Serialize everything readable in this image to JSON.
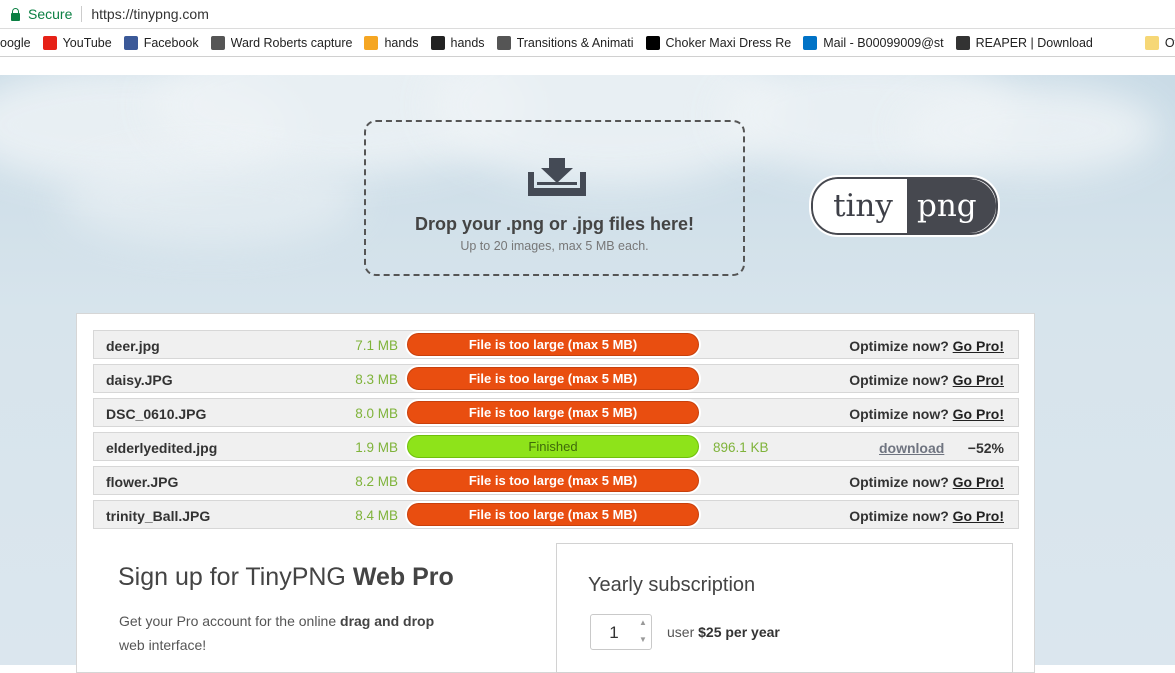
{
  "browser": {
    "secure_label": "Secure",
    "url": "https://tinypng.com",
    "bookmarks": [
      {
        "label": "oogle",
        "icon": "google-icon",
        "color": "#4285f4"
      },
      {
        "label": "YouTube",
        "icon": "youtube-icon",
        "color": "#e62117"
      },
      {
        "label": "Facebook",
        "icon": "facebook-icon",
        "color": "#3b5998"
      },
      {
        "label": "Ward Roberts capture",
        "icon": "people-icon",
        "color": "#555555"
      },
      {
        "label": "hands",
        "icon": "ic-icon",
        "color": "#f5a623"
      },
      {
        "label": "hands",
        "icon": "image-thumb-icon",
        "color": "#222222"
      },
      {
        "label": "Transitions & Animati",
        "icon": "code-icon",
        "color": "#555555"
      },
      {
        "label": "Choker Maxi Dress Re",
        "icon": "m-logo-icon",
        "color": "#000000"
      },
      {
        "label": "Mail - B00099009@st",
        "icon": "outlook-icon",
        "color": "#0072c6"
      },
      {
        "label": "REAPER | Download",
        "icon": "reaper-icon",
        "color": "#333333"
      },
      {
        "label": "Other",
        "icon": "folder-icon",
        "color": "#f6d776"
      }
    ]
  },
  "dropzone": {
    "title": "Drop your .png or .jpg files here!",
    "subtitle": "Up to 20 images, max 5 MB each."
  },
  "logo": {
    "left": "tiny",
    "right": "png"
  },
  "files": [
    {
      "name": "deer.jpg",
      "size": "7.1 MB",
      "status": "File is too large (max 5 MB)",
      "state": "error",
      "optimize": "Optimize now?",
      "gopro": "Go Pro!"
    },
    {
      "name": "daisy.JPG",
      "size": "8.3 MB",
      "status": "File is too large (max 5 MB)",
      "state": "error",
      "optimize": "Optimize now?",
      "gopro": "Go Pro!"
    },
    {
      "name": "DSC_0610.JPG",
      "size": "8.0 MB",
      "status": "File is too large (max 5 MB)",
      "state": "error",
      "optimize": "Optimize now?",
      "gopro": "Go Pro!"
    },
    {
      "name": "elderlyedited.jpg",
      "size": "1.9 MB",
      "status": "Finished",
      "state": "finished",
      "new_size": "896.1 KB",
      "download": "download",
      "saving": "−52%"
    },
    {
      "name": "flower.JPG",
      "size": "8.2 MB",
      "status": "File is too large (max 5 MB)",
      "state": "error",
      "optimize": "Optimize now?",
      "gopro": "Go Pro!"
    },
    {
      "name": "trinity_Ball.JPG",
      "size": "8.4 MB",
      "status": "File is too large (max 5 MB)",
      "state": "error",
      "optimize": "Optimize now?",
      "gopro": "Go Pro!"
    }
  ],
  "pro": {
    "title_prefix": "Sign up for TinyPNG ",
    "title_bold": "Web Pro",
    "text_prefix": "Get your Pro account for the online ",
    "text_bold": "drag and drop",
    "text_suffix": " web interface!"
  },
  "subscription": {
    "title": "Yearly subscription",
    "quantity": "1",
    "label_prefix": "user ",
    "label_bold": "$25 per year"
  },
  "colors": {
    "error": "#e94e10",
    "finished": "#8ee31a",
    "size_green": "#7fb33a",
    "secure_green": "#0b8043"
  }
}
